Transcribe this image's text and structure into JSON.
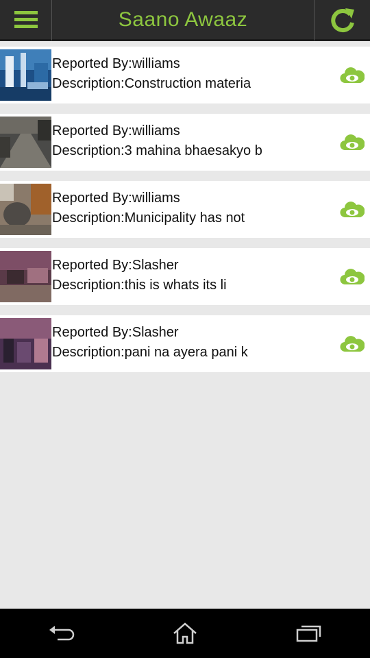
{
  "app": {
    "title": "Saano Awaaz"
  },
  "colors": {
    "accent": "#8dc63f",
    "topbar": "#2b2b2b",
    "background": "#e8e8e8"
  },
  "reports": [
    {
      "reporter": "Reported By:williams",
      "description": "Description:Construction materia"
    },
    {
      "reporter": "Reported By:williams",
      "description": "Description:3 mahina bhaesakyo b"
    },
    {
      "reporter": "Reported By:williams",
      "description": "Description:Municipality has not"
    },
    {
      "reporter": "Reported By:Slasher",
      "description": "Description:this is whats its li"
    },
    {
      "reporter": "Reported By:Slasher",
      "description": "Description:pani na ayera pani k"
    }
  ],
  "icons": {
    "menu": "hamburger-menu-icon",
    "refresh": "refresh-icon",
    "view": "cloud-eye-icon",
    "back": "back-icon",
    "home": "home-icon",
    "recents": "recent-apps-icon"
  }
}
